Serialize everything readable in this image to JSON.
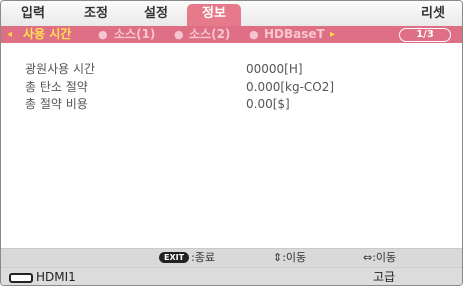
{
  "menu": {
    "items": [
      {
        "label": "입력"
      },
      {
        "label": "조정"
      },
      {
        "label": "설정"
      },
      {
        "label": "정보",
        "active": true
      },
      {
        "label": "리셋"
      }
    ]
  },
  "subtabs": {
    "left_arrow": "◂",
    "right_arrow": "▸",
    "separator": "●",
    "items": [
      {
        "label": "사용 시간",
        "selected": true
      },
      {
        "label": "소스(1)"
      },
      {
        "label": "소스(2)"
      },
      {
        "label": "HDBaseT"
      }
    ],
    "page_indicator": "1/3"
  },
  "info": {
    "rows": [
      {
        "label": "광원사용 시간",
        "value": "00000[H]"
      },
      {
        "label": "총 탄소 절약",
        "value": "0.000[kg-CO2]"
      },
      {
        "label": "총 절약 비용",
        "value": "0.00[$]"
      }
    ]
  },
  "help": {
    "exit_key": "EXIT",
    "exit_text": ":종료",
    "updown_symbol": "⇕",
    "updown_text": ":이동",
    "leftright_symbol": "⇔",
    "leftright_text": ":이동"
  },
  "status": {
    "input_name": "HDMI1",
    "mode": "고급",
    "input_icon": "input-connector-icon"
  },
  "colors": {
    "accent": "#df6f84",
    "tab_active": "#e77a8a",
    "selected_text": "#ffe14f"
  }
}
